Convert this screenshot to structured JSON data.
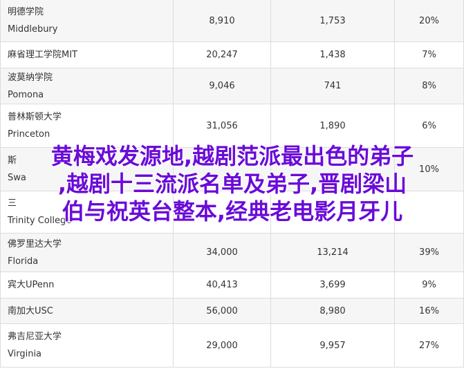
{
  "rows": [
    {
      "name_cn": "明德学院",
      "name_en": "Middlebury",
      "applicants": "8,910",
      "admitted": "1,753",
      "rate": "20%"
    },
    {
      "name_cn": "麻省理工学院MIT",
      "name_en": "",
      "applicants": "20,247",
      "admitted": "1,438",
      "rate": "7%"
    },
    {
      "name_cn": "波莫纳学院",
      "name_en": "Pomona",
      "applicants": "9,046",
      "admitted": "741",
      "rate": "8%"
    },
    {
      "name_cn": "普林斯顿大学",
      "name_en": "Princeton",
      "applicants": "31,056",
      "admitted": "1,890",
      "rate": "6%"
    },
    {
      "name_cn": "斯",
      "name_en": "Swa",
      "applicants": "",
      "admitted": "",
      "rate": "10%"
    },
    {
      "name_cn": "三",
      "name_en": "Trinity College",
      "applicants": "",
      "admitted": "",
      "rate": ""
    },
    {
      "name_cn": "佛罗里达大学",
      "name_en": "Florida",
      "applicants": "34,000",
      "admitted": "13,214",
      "rate": "39%"
    },
    {
      "name_cn": "宾大UPenn",
      "name_en": "",
      "applicants": "40,413",
      "admitted": "3,699",
      "rate": "9%"
    },
    {
      "name_cn": "南加大USC",
      "name_en": "",
      "applicants": "56,000",
      "admitted": "8,980",
      "rate": "16%"
    },
    {
      "name_cn": "弗吉尼亚大学",
      "name_en": "Virginia",
      "applicants": "29,000",
      "admitted": "9,957",
      "rate": "27%"
    }
  ],
  "overlay": {
    "line1": "黄梅戏发源地,越剧范派最出色的弟子",
    "line2": ",越剧十三流派名单及弟子,晋剧梁山",
    "line3": "伯与祝英台整本,经典老电影月牙儿",
    "color": "#6a0bd8"
  }
}
